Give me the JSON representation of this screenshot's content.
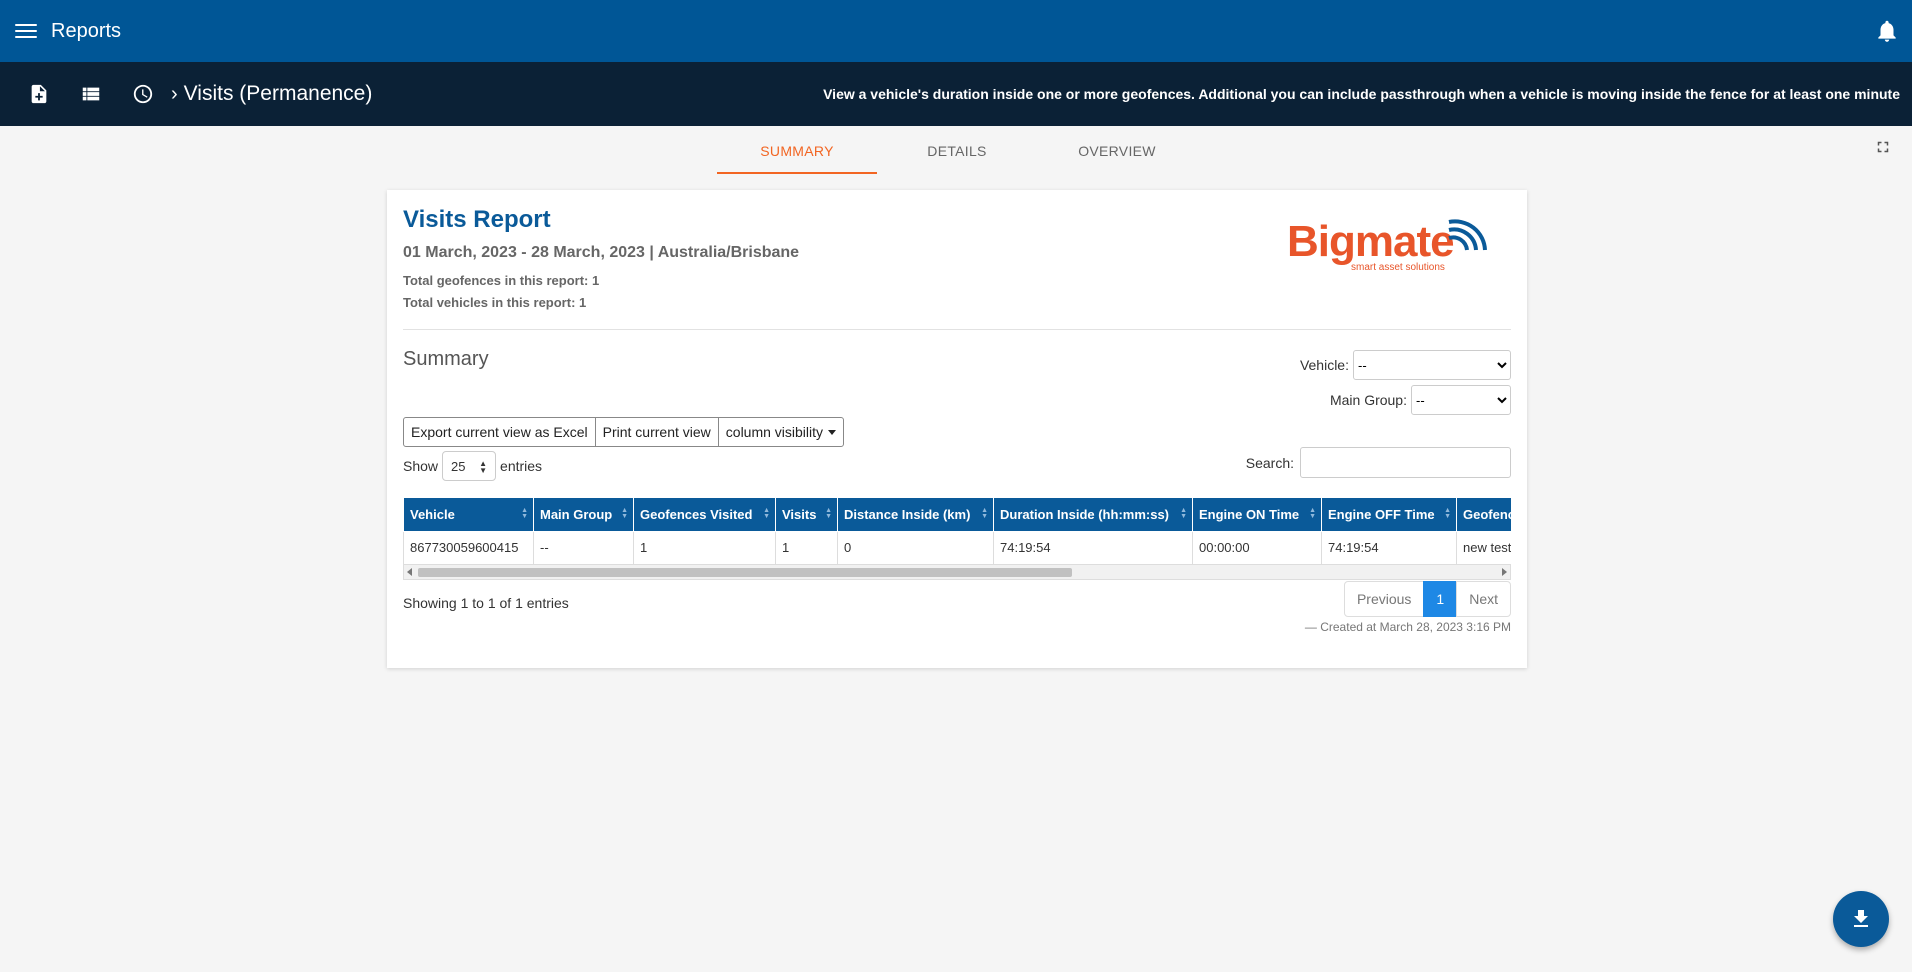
{
  "app": {
    "title": "Reports"
  },
  "toolbar": {
    "breadcrumb": "Visits (Permanence)",
    "description": "View a vehicle's duration inside one or more geofences. Additional you can include passthrough when a vehicle is moving inside the fence for at least one minute"
  },
  "tabs": [
    {
      "label": "SUMMARY",
      "active": true
    },
    {
      "label": "DETAILS",
      "active": false
    },
    {
      "label": "OVERVIEW",
      "active": false
    }
  ],
  "report": {
    "title": "Visits Report",
    "dates": "01 March, 2023 - 28 March, 2023 | Australia/Brisbane",
    "total_geofences": "Total geofences in this report: 1",
    "total_vehicles": "Total vehicles in this report: 1",
    "logo": {
      "brand": "Bigmate",
      "tagline": "smart asset solutions"
    }
  },
  "summary": {
    "title": "Summary",
    "vehicle_filter": {
      "label": "Vehicle:",
      "value": "--"
    },
    "group_filter": {
      "label": "Main Group:",
      "value": "--"
    },
    "buttons": {
      "export": "Export current view as Excel",
      "print": "Print current view",
      "columns": "column visibility"
    },
    "length": {
      "show": "Show",
      "value": "25",
      "entries": "entries"
    },
    "search": {
      "label": "Search:",
      "value": ""
    },
    "columns": [
      "Vehicle",
      "Main Group",
      "Geofences Visited",
      "Visits",
      "Distance Inside (km)",
      "Duration Inside (hh:mm:ss)",
      "Engine ON Time",
      "Engine OFF Time",
      "Geofences"
    ],
    "rows": [
      [
        "867730059600415",
        "--",
        "1",
        "1",
        "0",
        "74:19:54",
        "00:00:00",
        "74:19:54",
        "new test"
      ]
    ],
    "info": "Showing 1 to 1 of 1 entries",
    "pagination": {
      "previous": "Previous",
      "current": "1",
      "next": "Next"
    },
    "created": "— Created at March 28, 2023 3:16 PM"
  },
  "colors": {
    "primary": "#005696",
    "toolbar": "#0b2136",
    "accent": "#f26522",
    "table_header": "#0a5a99",
    "page_active": "#1e88e5"
  }
}
